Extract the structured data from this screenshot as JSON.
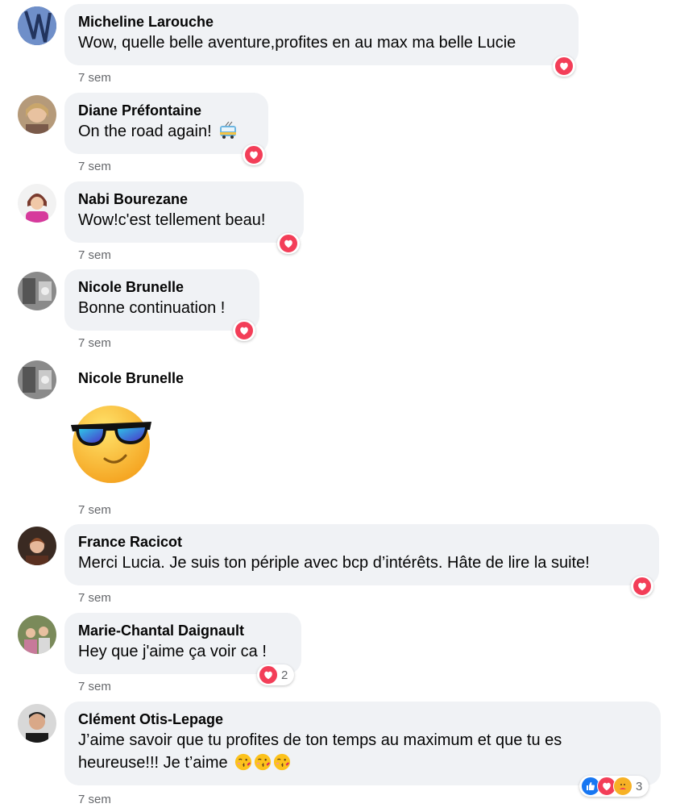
{
  "comments": [
    {
      "author": "Micheline Larouche",
      "text": "Wow, quelle belle aventure,profites en au max ma belle Lucie",
      "time": "7 sem",
      "reactions": [
        {
          "type": "love"
        }
      ],
      "count": ""
    },
    {
      "author": "Diane Préfontaine",
      "text": "On the road again!",
      "emoji": "trolleybus",
      "time": "7 sem",
      "reactions": [
        {
          "type": "love"
        }
      ],
      "count": ""
    },
    {
      "author": "Nabi Bourezane",
      "text": "Wow!c'est tellement beau!",
      "time": "7 sem",
      "reactions": [
        {
          "type": "love"
        }
      ],
      "count": ""
    },
    {
      "author": "Nicole Brunelle",
      "text": "Bonne continuation !",
      "time": "7 sem",
      "reactions": [
        {
          "type": "love"
        }
      ],
      "count": ""
    },
    {
      "author": "Nicole Brunelle",
      "sticker": "sunglasses-face",
      "time": "7 sem"
    },
    {
      "author": "France Racicot",
      "text": "Merci Lucia. Je suis ton périple avec bcp d’intérêts. Hâte de lire la suite!",
      "time": "7 sem",
      "reactions": [
        {
          "type": "love"
        }
      ],
      "count": ""
    },
    {
      "author": "Marie-Chantal Daignault",
      "text": "Hey que j'aime ça voir ca !",
      "time": "7 sem",
      "reactions": [
        {
          "type": "love"
        }
      ],
      "count": "2"
    },
    {
      "author": "Clément Otis-Lepage",
      "text_line1": "J’aime savoir que tu profites de ton temps au maximum et que tu es",
      "text_line2": "heureuse!!! Je t’aime",
      "emoji": "kissing-face x3",
      "time": "7 sem",
      "reactions": [
        {
          "type": "like"
        },
        {
          "type": "love"
        },
        {
          "type": "care"
        }
      ],
      "count": "3"
    }
  ],
  "colors": {
    "bubble": "#f0f2f5",
    "love": "#f33e58",
    "like": "#1877f2",
    "time": "#65676b"
  }
}
